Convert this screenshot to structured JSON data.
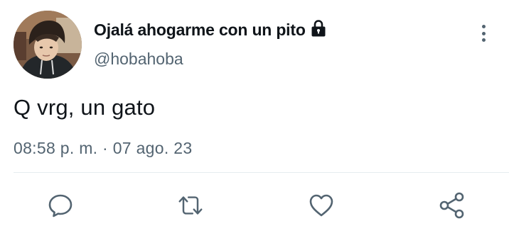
{
  "tweet": {
    "display_name": "Ojalá ahogarme con un pito",
    "handle": "@hobahoba",
    "text": "Q vrg, un gato",
    "timestamp": "08:58 p. m. · 07 ago. 23",
    "protected_icon": "lock-icon",
    "more_icon": "vertical-ellipsis-icon"
  },
  "actions": [
    {
      "name": "reply",
      "icon": "speech-bubble-icon"
    },
    {
      "name": "retweet",
      "icon": "retweet-icon"
    },
    {
      "name": "like",
      "icon": "heart-icon"
    },
    {
      "name": "share",
      "icon": "share-icon"
    }
  ],
  "colors": {
    "text": "#0f1419",
    "secondary_text": "#536471",
    "divider": "#e6ecf0",
    "icon": "#536471"
  }
}
